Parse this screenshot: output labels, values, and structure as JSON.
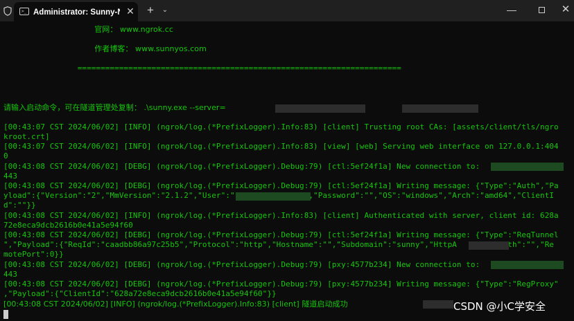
{
  "window": {
    "tab_title": "Administrator: Sunny-NgrokJ",
    "tab_close": "✕",
    "new_tab": "+",
    "dropdown": "⌄",
    "minimize": "—",
    "close": "✕"
  },
  "terminal": {
    "lines": [
      "                                     官网： www.ngrok.cc",
      "",
      "                                     作者博客： www.sunnyos.com",
      "",
      "                ======================================================================",
      "",
      "",
      "",
      "请输入启动命令，可在隧道管理处复制： .\\sunny.exe --server=                          --key=5",
      "",
      "[00:43:07 CST 2024/06/02] [INFO] (ngrok/log.(*PrefixLogger).Info:83) [client] Trusting root CAs: [assets/client/tls/ngro",
      "kroot.crt]",
      "[00:43:07 CST 2024/06/02] [INFO] (ngrok/log.(*PrefixLogger).Info:83) [view] [web] Serving web interface on 127.0.0.1:404",
      "0",
      "[00:43:08 CST 2024/06/02] [DEBG] (ngrok/log.(*PrefixLogger).Debug:79) [ctl:5ef24f1a] New connection to: ",
      "443",
      "[00:43:08 CST 2024/06/02] [DEBG] (ngrok/log.(*PrefixLogger).Debug:79) [ctl:5ef24f1a] Writing message: {\"Type\":\"Auth\",\"Pa",
      "yload\":{\"Version\":\"2\",\"MmVersion\":\"2.1.2\",\"User\":\"              4\",\"Password\":\"\",\"OS\":\"windows\",\"Arch\":\"amd64\",\"ClientI",
      "d\":\"\"}}",
      "[00:43:08 CST 2024/06/02] [INFO] (ngrok/log.(*PrefixLogger).Info:83) [client] Authenticated with server, client id: 628a",
      "72e8eca9dcb2616b0e41a5e94f60",
      "[00:43:08 CST 2024/06/02] [DEBG] (ngrok/log.(*PrefixLogger).Debug:79) [ctl:5ef24f1a] Writing message: {\"Type\":\"ReqTunnel",
      "\",\"Payload\":{\"ReqId\":\"caadbb86a97c25b5\",\"Protocol\":\"http\",\"Hostname\":\"\",\"Subdomain\":\"sunny\",\"HttpA         Auth\":\"\",\"Re",
      "motePort\":0}}",
      "[00:43:08 CST 2024/06/02] [DEBG] (ngrok/log.(*PrefixLogger).Debug:79) [pxy:4577b234] New connection to: ",
      "443",
      "[00:43:08 CST 2024/06/02] [DEBG] (ngrok/log.(*PrefixLogger).Debug:79) [pxy:4577b234] Writing message: {\"Type\":\"RegProxy\"",
      ",\"Payload\":{\"ClientId\":\"628a72e8eca9dcb2616b0e41a5e94f60\"}}",
      "[00:43:08 CST 2024/06/02] [INFO] (ngrok/log.(*PrefixLogger).Info:83) [client] 隧道启动成功 "
    ]
  },
  "watermark": "CSDN @小C学安全"
}
